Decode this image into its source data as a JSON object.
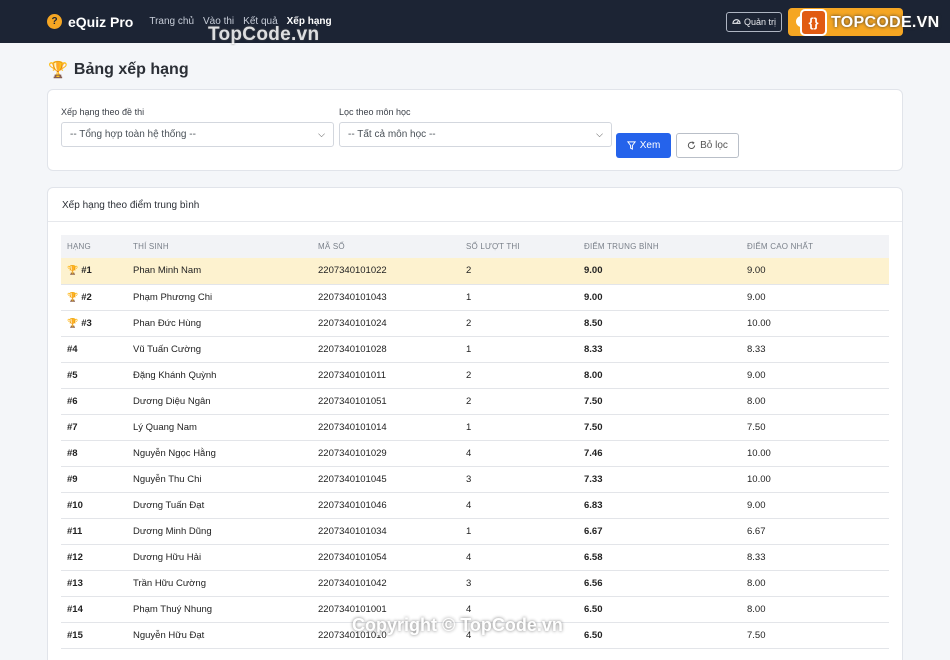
{
  "nav": {
    "brand": "eQuiz Pro",
    "brand_icon": "?",
    "links": [
      "Trang chủ",
      "Vào thi",
      "Kết quả",
      "Xếp hạng"
    ],
    "admin_label": "Quản trị"
  },
  "watermarks": {
    "top": "TopCode.vn",
    "logo_text": "TOPCODE.VN",
    "bottom": "Copyright © TopCode.vn"
  },
  "page": {
    "title": "Bảng xếp hạng"
  },
  "filters": {
    "exam_label": "Xếp hạng theo đề thi",
    "exam_value": "-- Tổng hợp toàn hệ thống --",
    "subject_label": "Lọc theo môn học",
    "subject_value": "-- Tất cả môn học --",
    "view_button": "Xem",
    "reset_button": "Bỏ lọc"
  },
  "ranking": {
    "title": "Xếp hạng theo điểm trung bình",
    "columns": [
      "HẠNG",
      "THÍ SINH",
      "MÃ SỐ",
      "SỐ LƯỢT THI",
      "ĐIỂM TRUNG BÌNH",
      "ĐIỂM CAO NHẤT"
    ],
    "rows": [
      {
        "rank": "#1",
        "name": "Phan Minh Nam",
        "id": "2207340101022",
        "attempts": "2",
        "avg": "9.00",
        "max": "9.00",
        "medal": "gold"
      },
      {
        "rank": "#2",
        "name": "Phạm Phương Chi",
        "id": "2207340101043",
        "attempts": "1",
        "avg": "9.00",
        "max": "9.00",
        "medal": "silver"
      },
      {
        "rank": "#3",
        "name": "Phan Đức Hùng",
        "id": "2207340101024",
        "attempts": "2",
        "avg": "8.50",
        "max": "10.00",
        "medal": "bronze"
      },
      {
        "rank": "#4",
        "name": "Vũ Tuấn Cường",
        "id": "2207340101028",
        "attempts": "1",
        "avg": "8.33",
        "max": "8.33",
        "medal": ""
      },
      {
        "rank": "#5",
        "name": "Đặng Khánh Quỳnh",
        "id": "2207340101011",
        "attempts": "2",
        "avg": "8.00",
        "max": "9.00",
        "medal": ""
      },
      {
        "rank": "#6",
        "name": "Dương Diệu Ngân",
        "id": "2207340101051",
        "attempts": "2",
        "avg": "7.50",
        "max": "8.00",
        "medal": ""
      },
      {
        "rank": "#7",
        "name": "Lý Quang Nam",
        "id": "2207340101014",
        "attempts": "1",
        "avg": "7.50",
        "max": "7.50",
        "medal": ""
      },
      {
        "rank": "#8",
        "name": "Nguyễn Ngọc Hằng",
        "id": "2207340101029",
        "attempts": "4",
        "avg": "7.46",
        "max": "10.00",
        "medal": ""
      },
      {
        "rank": "#9",
        "name": "Nguyễn Thu Chi",
        "id": "2207340101045",
        "attempts": "3",
        "avg": "7.33",
        "max": "10.00",
        "medal": ""
      },
      {
        "rank": "#10",
        "name": "Dương Tuấn Đạt",
        "id": "2207340101046",
        "attempts": "4",
        "avg": "6.83",
        "max": "9.00",
        "medal": ""
      },
      {
        "rank": "#11",
        "name": "Dương Minh Dũng",
        "id": "2207340101034",
        "attempts": "1",
        "avg": "6.67",
        "max": "6.67",
        "medal": ""
      },
      {
        "rank": "#12",
        "name": "Dương Hữu Hải",
        "id": "2207340101054",
        "attempts": "4",
        "avg": "6.58",
        "max": "8.33",
        "medal": ""
      },
      {
        "rank": "#13",
        "name": "Trần Hữu Cường",
        "id": "2207340101042",
        "attempts": "3",
        "avg": "6.56",
        "max": "8.00",
        "medal": ""
      },
      {
        "rank": "#14",
        "name": "Phạm Thuý Nhung",
        "id": "2207340101001",
        "attempts": "4",
        "avg": "6.50",
        "max": "8.00",
        "medal": ""
      },
      {
        "rank": "#15",
        "name": "Nguyễn Hữu Đạt",
        "id": "2207340101010",
        "attempts": "4",
        "avg": "6.50",
        "max": "7.50",
        "medal": ""
      }
    ]
  }
}
